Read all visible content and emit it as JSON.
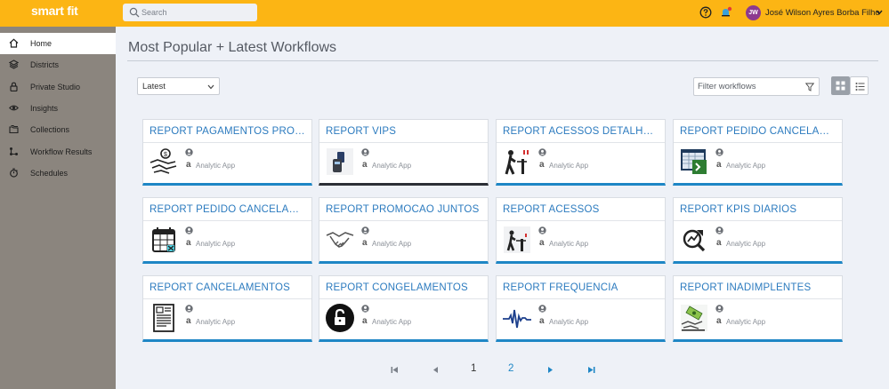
{
  "header": {
    "logo": "smart fit",
    "search_placeholder": "Search",
    "user": {
      "initials": "JW",
      "name": "José Wilson Ayres Borba Filho"
    }
  },
  "sidebar": {
    "items": [
      {
        "label": "Home",
        "icon": "home-icon",
        "active": true
      },
      {
        "label": "Districts",
        "icon": "layers-icon"
      },
      {
        "label": "Private Studio",
        "icon": "lock-icon"
      },
      {
        "label": "Insights",
        "icon": "eye-icon"
      },
      {
        "label": "Collections",
        "icon": "folders-icon"
      },
      {
        "label": "Workflow Results",
        "icon": "workflow-icon"
      },
      {
        "label": "Schedules",
        "icon": "stopwatch-icon"
      }
    ]
  },
  "main": {
    "title": "Most Popular + Latest Workflows",
    "sort": {
      "selected": "Latest"
    },
    "filter_placeholder": "Filter workflows",
    "cards": [
      {
        "title": "REPORT PAGAMENTOS PROMO ...",
        "type": "Analytic App",
        "alpha": "a",
        "icon": "hand-money-icon"
      },
      {
        "title": "REPORT VIPS",
        "type": "Analytic App",
        "alpha": "a",
        "icon": "card-terminal-icon"
      },
      {
        "title": "REPORT ACESSOS DETALHADOS ...",
        "type": "Analytic App",
        "alpha": "a",
        "icon": "turnstile-icon"
      },
      {
        "title": "REPORT PEDIDO CANCELAMENT...",
        "type": "Analytic App",
        "alpha": "a",
        "icon": "excel-sheet-icon"
      },
      {
        "title": "REPORT PEDIDO CANCELAMENTO",
        "type": "Analytic App",
        "alpha": "a",
        "icon": "calendar-x-icon"
      },
      {
        "title": "REPORT PROMOCAO JUNTOS",
        "type": "Analytic App",
        "alpha": "a",
        "icon": "handshake-icon"
      },
      {
        "title": "REPORT ACESSOS",
        "type": "Analytic App",
        "alpha": "a",
        "icon": "turnstile-icon"
      },
      {
        "title": "REPORT KPIS DIARIOS",
        "type": "Analytic App",
        "alpha": "a",
        "icon": "search-chart-icon"
      },
      {
        "title": "REPORT CANCELAMENTOS",
        "type": "Analytic App",
        "alpha": "a",
        "icon": "document-icon"
      },
      {
        "title": "REPORT CONGELAMENTOS",
        "type": "Analytic App",
        "alpha": "a",
        "icon": "padlock-circle-icon"
      },
      {
        "title": "REPORT FREQUENCIA",
        "type": "Analytic App",
        "alpha": "a",
        "icon": "heartbeat-icon"
      },
      {
        "title": "REPORT INADIMPLENTES",
        "type": "Analytic App",
        "alpha": "a",
        "icon": "money-hand-icon"
      }
    ]
  },
  "pagination": {
    "pages": [
      "1",
      "2"
    ],
    "current": "1"
  },
  "colors": {
    "header": "#fcb514",
    "sidebar": "#8b857e",
    "accent": "#1e86c5",
    "card_title": "#2c7bbf"
  }
}
